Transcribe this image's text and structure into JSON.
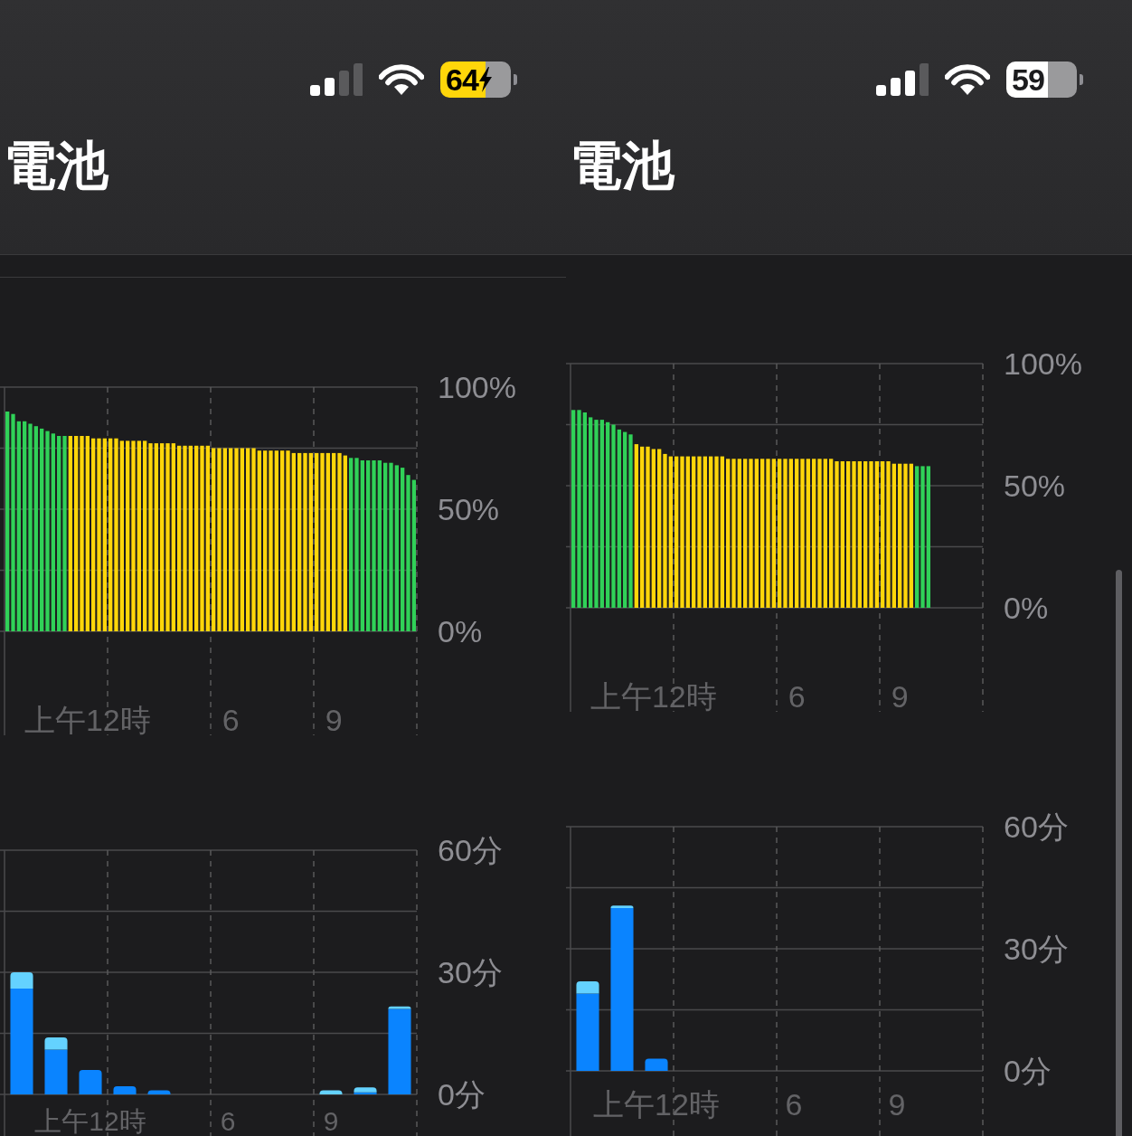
{
  "panels": [
    {
      "status_bar": {
        "battery": {
          "percent": "64",
          "charging": true,
          "low_power": true
        }
      },
      "title": "電池",
      "battery_chart": {
        "chart_data": {
          "type": "bar",
          "grid": true,
          "ylim": [
            0,
            100
          ],
          "categories": [
            null,
            null,
            null,
            null,
            null,
            null,
            null,
            null,
            null,
            null,
            null,
            null,
            null,
            null,
            "上午12時",
            null,
            null,
            null,
            null,
            null,
            null,
            null,
            null,
            null,
            null,
            null,
            null,
            null,
            null,
            null,
            null,
            null,
            null,
            null,
            null,
            null,
            null,
            null,
            null,
            "6",
            null,
            null,
            null,
            null,
            null,
            null,
            null,
            null,
            null,
            null,
            null,
            null,
            null,
            null,
            null,
            null,
            null,
            "9",
            null,
            null,
            null,
            null,
            null,
            null,
            null,
            null,
            null,
            null,
            null,
            null,
            null,
            null
          ],
          "yticks": [
            {
              "value": 100,
              "label": "100%"
            },
            {
              "value": 50,
              "label": "50%"
            },
            {
              "value": 0,
              "label": "0%"
            }
          ],
          "series": [
            {
              "color": "#30d158",
              "values": [
                90,
                89,
                86,
                86,
                85,
                84,
                83,
                82,
                81,
                80,
                80,
                null,
                null,
                null,
                null,
                null,
                null,
                null,
                null,
                null,
                null,
                null,
                null,
                null,
                null,
                null,
                null,
                null,
                null,
                null,
                null,
                null,
                null,
                null,
                null,
                null,
                null,
                null,
                null,
                null,
                null,
                null,
                null,
                null,
                null,
                null,
                null,
                null,
                null,
                null,
                null,
                null,
                null,
                null,
                null,
                null,
                null,
                null,
                null,
                null,
                71,
                71,
                70,
                70,
                70,
                70,
                69,
                69,
                68,
                67,
                64,
                62
              ]
            },
            {
              "color": "#ffd60a",
              "values": [
                null,
                null,
                null,
                null,
                null,
                null,
                null,
                null,
                null,
                null,
                null,
                80,
                80,
                80,
                80,
                79,
                79,
                79,
                79,
                79,
                78,
                78,
                78,
                78,
                78,
                77,
                77,
                77,
                77,
                77,
                76,
                76,
                76,
                76,
                76,
                76,
                75,
                75,
                75,
                75,
                75,
                75,
                75,
                75,
                74,
                74,
                74,
                74,
                74,
                74,
                73,
                73,
                73,
                73,
                73,
                73,
                73,
                73,
                73,
                72,
                null,
                null,
                null,
                null,
                null,
                null,
                null,
                null,
                null,
                null,
                null,
                null
              ]
            }
          ]
        }
      },
      "activity_chart": {
        "chart_data": {
          "type": "bar",
          "grid": true,
          "stacked": true,
          "ylim": [
            0,
            60
          ],
          "categories": [
            null,
            null,
            "上午12時",
            null,
            null,
            null,
            "6",
            null,
            null,
            "9",
            null,
            null
          ],
          "yticks": [
            {
              "value": 60,
              "label": "60分"
            },
            {
              "value": 30,
              "label": "30分"
            },
            {
              "value": 0,
              "label": "0分"
            }
          ],
          "series": [
            {
              "color": "#0a84ff",
              "values": [
                26,
                11,
                6,
                2,
                1,
                0,
                0,
                0,
                0,
                0,
                0.5,
                21
              ]
            },
            {
              "color": "#64d2ff",
              "values": [
                4,
                3,
                0,
                0,
                0,
                0,
                0,
                0,
                0,
                1,
                1.2,
                0.6
              ]
            }
          ]
        }
      }
    },
    {
      "status_bar": {
        "battery": {
          "percent": "59",
          "charging": false,
          "low_power": false
        }
      },
      "title": "電池",
      "battery_chart": {
        "chart_data": {
          "type": "bar",
          "grid": true,
          "ylim": [
            0,
            100
          ],
          "categories": [
            null,
            null,
            null,
            null,
            null,
            null,
            null,
            null,
            null,
            null,
            null,
            null,
            null,
            null,
            "上午12時",
            null,
            null,
            null,
            null,
            null,
            null,
            null,
            null,
            null,
            null,
            null,
            null,
            null,
            null,
            null,
            null,
            null,
            null,
            null,
            null,
            null,
            null,
            null,
            null,
            "6",
            null,
            null,
            null,
            null,
            null,
            null,
            null,
            null,
            null,
            null,
            null,
            null,
            null,
            null,
            null,
            null,
            null,
            "9",
            null,
            null,
            null,
            null,
            null,
            null,
            null,
            null,
            null,
            null,
            null,
            null,
            null,
            null
          ],
          "yticks": [
            {
              "value": 100,
              "label": "100%"
            },
            {
              "value": 50,
              "label": "50%"
            },
            {
              "value": 0,
              "label": "0%"
            }
          ],
          "series": [
            {
              "color": "#30d158",
              "values": [
                81,
                81,
                80,
                78,
                77,
                77,
                76,
                75,
                73,
                72,
                71,
                null,
                null,
                null,
                null,
                null,
                null,
                null,
                null,
                null,
                null,
                null,
                null,
                null,
                null,
                null,
                null,
                null,
                null,
                null,
                null,
                null,
                null,
                null,
                null,
                null,
                null,
                null,
                null,
                null,
                null,
                null,
                null,
                null,
                null,
                null,
                null,
                null,
                null,
                null,
                null,
                null,
                null,
                null,
                null,
                null,
                null,
                null,
                null,
                null,
                58,
                58,
                58,
                null,
                null,
                null,
                null,
                null,
                null,
                null,
                null,
                null
              ]
            },
            {
              "color": "#ffd60a",
              "values": [
                null,
                null,
                null,
                null,
                null,
                null,
                null,
                null,
                null,
                null,
                null,
                67,
                66,
                66,
                65,
                65,
                63,
                62,
                62,
                62,
                62,
                62,
                62,
                62,
                62,
                62,
                62,
                61,
                61,
                61,
                61,
                61,
                61,
                61,
                61,
                61,
                61,
                61,
                61,
                61,
                61,
                61,
                61,
                61,
                61,
                61,
                60,
                60,
                60,
                60,
                60,
                60,
                60,
                60,
                60,
                60,
                59,
                59,
                59,
                59,
                null,
                null,
                null,
                null,
                null,
                null,
                null,
                null,
                null,
                null,
                null,
                null
              ]
            }
          ]
        }
      },
      "activity_chart": {
        "chart_data": {
          "type": "bar",
          "grid": true,
          "stacked": true,
          "ylim": [
            0,
            60
          ],
          "categories": [
            null,
            null,
            "上午12時",
            null,
            null,
            null,
            "6",
            null,
            null,
            "9",
            null,
            null
          ],
          "yticks": [
            {
              "value": 60,
              "label": "60分"
            },
            {
              "value": 30,
              "label": "30分"
            },
            {
              "value": 0,
              "label": "0分"
            }
          ],
          "series": [
            {
              "color": "#0a84ff",
              "values": [
                19,
                40,
                3,
                0,
                0,
                0,
                0,
                0,
                0,
                0,
                0,
                0
              ]
            },
            {
              "color": "#64d2ff",
              "values": [
                3,
                0.6,
                0,
                0,
                0,
                0,
                0,
                0,
                0,
                0,
                0,
                0
              ]
            }
          ]
        }
      }
    }
  ]
}
